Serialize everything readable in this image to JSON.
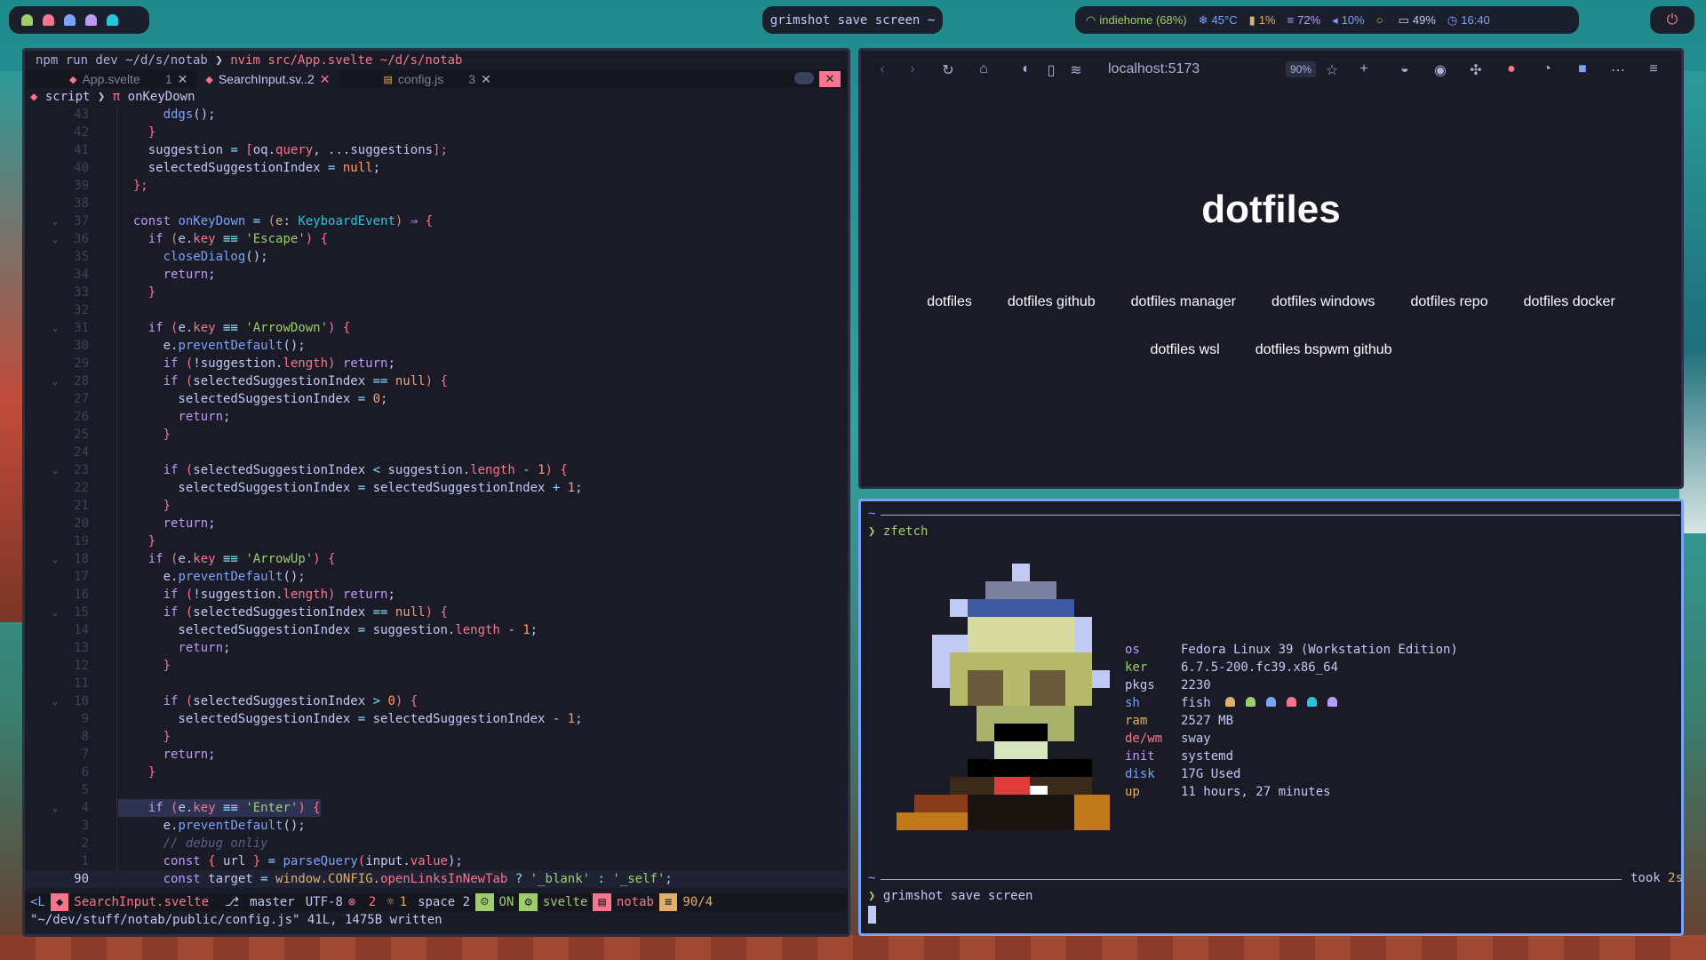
{
  "topbar": {
    "workspace_colors": [
      "#9ece6a",
      "#f7768e",
      "#7aa2f7",
      "#bb9af7",
      "#2ac3de"
    ],
    "screenshot_label": "grimshot save screen ~",
    "status": [
      {
        "icon": "wifi-icon",
        "text": "indiehome (68%)",
        "color": "#9ece6a"
      },
      {
        "icon": "temperature-icon",
        "text": "45°C",
        "color": "#7aa2f7"
      },
      {
        "icon": "cpu-icon",
        "text": "1%",
        "color": "#e0af68"
      },
      {
        "icon": "memory-icon",
        "text": "72%",
        "color": "#bb9af7"
      },
      {
        "icon": "volume-icon",
        "text": "10%",
        "color": "#7aa2f7"
      },
      {
        "icon": "idle-icon",
        "text": "",
        "color": "#e0af68"
      },
      {
        "icon": "battery-icon",
        "text": "49%",
        "color": "#c0caf5"
      },
      {
        "icon": "clock-icon",
        "text": "16:40",
        "color": "#7aa2f7"
      }
    ],
    "power_icon": "power-icon"
  },
  "editor": {
    "title_prefix": "npm run dev ~/d/s/notab",
    "title_cmd": "nvim src/App.svelte ~/d/s/notab",
    "tabs": [
      {
        "name": "App.svelte",
        "count": "1",
        "active": false,
        "icon": "svelte-icon"
      },
      {
        "name": "SearchInput.sv..2",
        "count": "",
        "active": true,
        "icon": "svelte-icon"
      },
      {
        "name": "config.js",
        "count": "3",
        "active": false,
        "icon": "js-icon"
      }
    ],
    "breadcrumb": [
      "script",
      "onKeyDown"
    ],
    "lines": [
      {
        "n": "43",
        "fold": "",
        "code": [
          [
            "      ",
            "v"
          ],
          [
            "ddgs",
            "f"
          ],
          [
            "();",
            "v"
          ]
        ]
      },
      {
        "n": "42",
        "fold": "",
        "code": [
          [
            "    }",
            "p"
          ]
        ]
      },
      {
        "n": "41",
        "fold": "",
        "code": [
          [
            "    suggestion ",
            "v"
          ],
          [
            "=",
            "o"
          ],
          [
            " [",
            "p"
          ],
          [
            "oq.",
            "v"
          ],
          [
            "query",
            "p"
          ],
          [
            ", ...suggestions",
            "v"
          ],
          [
            "];",
            "p"
          ]
        ]
      },
      {
        "n": "40",
        "fold": "",
        "code": [
          [
            "    selectedSuggestionIndex ",
            "v"
          ],
          [
            "=",
            "o"
          ],
          [
            " null",
            "n"
          ],
          [
            ";",
            "v"
          ]
        ]
      },
      {
        "n": "39",
        "fold": "",
        "code": [
          [
            "  };",
            "p"
          ]
        ]
      },
      {
        "n": "38",
        "fold": "",
        "code": [
          [
            "",
            "v"
          ]
        ]
      },
      {
        "n": "37",
        "fold": "v",
        "code": [
          [
            "  ",
            "v"
          ],
          [
            "const",
            "k"
          ],
          [
            " onKeyDown ",
            "f"
          ],
          [
            "=",
            "o"
          ],
          [
            " (",
            "p"
          ],
          [
            "e",
            "r"
          ],
          [
            ": ",
            "v"
          ],
          [
            "KeyboardEvent",
            "t"
          ],
          [
            ") ",
            "p"
          ],
          [
            "⇒",
            "k"
          ],
          [
            " {",
            "p"
          ]
        ]
      },
      {
        "n": "36",
        "fold": "v",
        "code": [
          [
            "    ",
            "v"
          ],
          [
            "if",
            "k"
          ],
          [
            " (",
            "p"
          ],
          [
            "e.",
            "v"
          ],
          [
            "key",
            "p"
          ],
          [
            " ≡≡ ",
            "o"
          ],
          [
            "'Escape'",
            "s"
          ],
          [
            ") {",
            "p"
          ]
        ]
      },
      {
        "n": "35",
        "fold": "",
        "code": [
          [
            "      ",
            "v"
          ],
          [
            "closeDialog",
            "f"
          ],
          [
            "();",
            "v"
          ]
        ]
      },
      {
        "n": "34",
        "fold": "",
        "code": [
          [
            "      ",
            "v"
          ],
          [
            "return",
            "k"
          ],
          [
            ";",
            "v"
          ]
        ]
      },
      {
        "n": "33",
        "fold": "",
        "code": [
          [
            "    }",
            "p"
          ]
        ]
      },
      {
        "n": "32",
        "fold": "",
        "code": [
          [
            "",
            "v"
          ]
        ]
      },
      {
        "n": "31",
        "fold": "v",
        "code": [
          [
            "    ",
            "v"
          ],
          [
            "if",
            "k"
          ],
          [
            " (",
            "p"
          ],
          [
            "e.",
            "v"
          ],
          [
            "key",
            "p"
          ],
          [
            " ≡≡ ",
            "o"
          ],
          [
            "'ArrowDown'",
            "s"
          ],
          [
            ") {",
            "p"
          ]
        ]
      },
      {
        "n": "30",
        "fold": "",
        "code": [
          [
            "      e.",
            "v"
          ],
          [
            "preventDefault",
            "f"
          ],
          [
            "();",
            "v"
          ]
        ]
      },
      {
        "n": "29",
        "fold": "",
        "code": [
          [
            "      ",
            "v"
          ],
          [
            "if",
            "k"
          ],
          [
            " (",
            "p"
          ],
          [
            "!",
            "o"
          ],
          [
            "suggestion.",
            "v"
          ],
          [
            "length",
            "p"
          ],
          [
            ") ",
            "p"
          ],
          [
            "return",
            "k"
          ],
          [
            ";",
            "v"
          ]
        ]
      },
      {
        "n": "28",
        "fold": "v",
        "code": [
          [
            "      ",
            "v"
          ],
          [
            "if",
            "k"
          ],
          [
            " (",
            "p"
          ],
          [
            "selectedSuggestionIndex ",
            "v"
          ],
          [
            "==",
            "o"
          ],
          [
            " null",
            "n"
          ],
          [
            ") {",
            "p"
          ]
        ]
      },
      {
        "n": "27",
        "fold": "",
        "code": [
          [
            "        selectedSuggestionIndex ",
            "v"
          ],
          [
            "=",
            "o"
          ],
          [
            " 0",
            "n"
          ],
          [
            ";",
            "v"
          ]
        ]
      },
      {
        "n": "26",
        "fold": "",
        "code": [
          [
            "        ",
            "v"
          ],
          [
            "return",
            "k"
          ],
          [
            ";",
            "v"
          ]
        ]
      },
      {
        "n": "25",
        "fold": "",
        "code": [
          [
            "      }",
            "p"
          ]
        ]
      },
      {
        "n": "24",
        "fold": "",
        "code": [
          [
            "",
            "v"
          ]
        ]
      },
      {
        "n": "23",
        "fold": "v",
        "code": [
          [
            "      ",
            "v"
          ],
          [
            "if",
            "k"
          ],
          [
            " (",
            "p"
          ],
          [
            "selectedSuggestionIndex ",
            "v"
          ],
          [
            "<",
            "o"
          ],
          [
            " suggestion.",
            "v"
          ],
          [
            "length",
            "p"
          ],
          [
            " - ",
            "o"
          ],
          [
            "1",
            "n"
          ],
          [
            ") {",
            "p"
          ]
        ]
      },
      {
        "n": "22",
        "fold": "",
        "code": [
          [
            "        selectedSuggestionIndex ",
            "v"
          ],
          [
            "=",
            "o"
          ],
          [
            " selectedSuggestionIndex ",
            "v"
          ],
          [
            "+",
            "o"
          ],
          [
            " 1",
            "n"
          ],
          [
            ";",
            "v"
          ]
        ]
      },
      {
        "n": "21",
        "fold": "",
        "code": [
          [
            "      }",
            "p"
          ]
        ]
      },
      {
        "n": "20",
        "fold": "",
        "code": [
          [
            "      ",
            "v"
          ],
          [
            "return",
            "k"
          ],
          [
            ";",
            "v"
          ]
        ]
      },
      {
        "n": "19",
        "fold": "",
        "code": [
          [
            "    }",
            "p"
          ]
        ]
      },
      {
        "n": "18",
        "fold": "v",
        "code": [
          [
            "    ",
            "v"
          ],
          [
            "if",
            "k"
          ],
          [
            " (",
            "p"
          ],
          [
            "e.",
            "v"
          ],
          [
            "key",
            "p"
          ],
          [
            " ≡≡ ",
            "o"
          ],
          [
            "'ArrowUp'",
            "s"
          ],
          [
            ") {",
            "p"
          ]
        ]
      },
      {
        "n": "17",
        "fold": "",
        "code": [
          [
            "      e.",
            "v"
          ],
          [
            "preventDefault",
            "f"
          ],
          [
            "();",
            "v"
          ]
        ]
      },
      {
        "n": "16",
        "fold": "",
        "code": [
          [
            "      ",
            "v"
          ],
          [
            "if",
            "k"
          ],
          [
            " (",
            "p"
          ],
          [
            "!",
            "o"
          ],
          [
            "suggestion.",
            "v"
          ],
          [
            "length",
            "p"
          ],
          [
            ") ",
            "p"
          ],
          [
            "return",
            "k"
          ],
          [
            ";",
            "v"
          ]
        ]
      },
      {
        "n": "15",
        "fold": "v",
        "code": [
          [
            "      ",
            "v"
          ],
          [
            "if",
            "k"
          ],
          [
            " (",
            "p"
          ],
          [
            "selectedSuggestionIndex ",
            "v"
          ],
          [
            "==",
            "o"
          ],
          [
            " null",
            "n"
          ],
          [
            ") {",
            "p"
          ]
        ]
      },
      {
        "n": "14",
        "fold": "",
        "code": [
          [
            "        selectedSuggestionIndex ",
            "v"
          ],
          [
            "=",
            "o"
          ],
          [
            " suggestion.",
            "v"
          ],
          [
            "length",
            "p"
          ],
          [
            " - ",
            "o"
          ],
          [
            "1",
            "n"
          ],
          [
            ";",
            "v"
          ]
        ]
      },
      {
        "n": "13",
        "fold": "",
        "code": [
          [
            "        ",
            "v"
          ],
          [
            "return",
            "k"
          ],
          [
            ";",
            "v"
          ]
        ]
      },
      {
        "n": "12",
        "fold": "",
        "code": [
          [
            "      }",
            "p"
          ]
        ]
      },
      {
        "n": "11",
        "fold": "",
        "code": [
          [
            "",
            "v"
          ]
        ]
      },
      {
        "n": "10",
        "fold": "v",
        "code": [
          [
            "      ",
            "v"
          ],
          [
            "if",
            "k"
          ],
          [
            " (",
            "p"
          ],
          [
            "selectedSuggestionIndex ",
            "v"
          ],
          [
            ">",
            "o"
          ],
          [
            " 0",
            "n"
          ],
          [
            ") {",
            "p"
          ]
        ]
      },
      {
        "n": "9",
        "fold": "",
        "code": [
          [
            "        selectedSuggestionIndex ",
            "v"
          ],
          [
            "=",
            "o"
          ],
          [
            " selectedSuggestionIndex ",
            "v"
          ],
          [
            "-",
            "o"
          ],
          [
            " 1",
            "n"
          ],
          [
            ";",
            "v"
          ]
        ]
      },
      {
        "n": "8",
        "fold": "",
        "code": [
          [
            "      }",
            "p"
          ]
        ]
      },
      {
        "n": "7",
        "fold": "",
        "code": [
          [
            "      ",
            "v"
          ],
          [
            "return",
            "k"
          ],
          [
            ";",
            "v"
          ]
        ]
      },
      {
        "n": "6",
        "fold": "",
        "code": [
          [
            "    }",
            "p"
          ]
        ]
      },
      {
        "n": "5",
        "fold": "",
        "code": [
          [
            "",
            "v"
          ]
        ]
      },
      {
        "n": "4",
        "fold": "v",
        "sel": true,
        "code": [
          [
            "    ",
            "v"
          ],
          [
            "if",
            "k"
          ],
          [
            " (",
            "p"
          ],
          [
            "e.",
            "v"
          ],
          [
            "key",
            "p"
          ],
          [
            " ≡≡ ",
            "o"
          ],
          [
            "'Enter'",
            "s"
          ],
          [
            ") {",
            "p"
          ]
        ]
      },
      {
        "n": "3",
        "fold": "",
        "code": [
          [
            "      e.",
            "v"
          ],
          [
            "preventDefault",
            "f"
          ],
          [
            "();",
            "v"
          ]
        ]
      },
      {
        "n": "2",
        "fold": "",
        "code": [
          [
            "      ",
            "v"
          ],
          [
            "// debug onliy",
            "c"
          ]
        ]
      },
      {
        "n": "1",
        "fold": "",
        "code": [
          [
            "      ",
            "v"
          ],
          [
            "const",
            "k"
          ],
          [
            " { ",
            "p"
          ],
          [
            "url",
            "v"
          ],
          [
            " } ",
            "p"
          ],
          [
            "=",
            "o"
          ],
          [
            " parseQuery",
            "f"
          ],
          [
            "(",
            "p"
          ],
          [
            "input.",
            "v"
          ],
          [
            "value",
            "p"
          ],
          [
            ");",
            "v"
          ]
        ]
      },
      {
        "n": "90",
        "fold": "",
        "cur": true,
        "code": [
          [
            "      ",
            "v"
          ],
          [
            "const",
            "k"
          ],
          [
            " target ",
            "v"
          ],
          [
            "=",
            "o"
          ],
          [
            " window.",
            "r"
          ],
          [
            "CONFIG",
            "r"
          ],
          [
            ".",
            "r"
          ],
          [
            "openLinksInNewTab",
            "p"
          ],
          [
            " ? ",
            "o"
          ],
          [
            "'_blank'",
            "s"
          ],
          [
            " : ",
            "o"
          ],
          [
            "'_self'",
            "s"
          ],
          [
            ";",
            "v"
          ]
        ]
      }
    ],
    "status": {
      "mode": "<L",
      "file": "SearchInput.svelte",
      "branch": "master",
      "encoding": "UTF-8",
      "errors": "2",
      "hints": "1",
      "indent": "space 2",
      "copilot": "ON",
      "filetype": "svelte",
      "project": "notab",
      "position": "90/4"
    },
    "cmdline": "\"~/dev/stuff/notab/public/config.js\" 41L, 1475B written"
  },
  "browser": {
    "url": "localhost:5173",
    "zoom": "90%",
    "page_title": "dotfiles",
    "links": [
      "dotfiles",
      "dotfiles github",
      "dotfiles manager",
      "dotfiles windows",
      "dotfiles repo",
      "dotfiles docker",
      "dotfiles wsl",
      "dotfiles bspwm github"
    ]
  },
  "terminal": {
    "prompt_symbol": "❯",
    "home": "~",
    "command1": "zfetch",
    "fetch": [
      {
        "label": "os",
        "value": "Fedora Linux 39 (Workstation Edition)",
        "color": "#bb9af7"
      },
      {
        "label": "ker",
        "value": "6.7.5-200.fc39.x86_64",
        "color": "#9ece6a"
      },
      {
        "label": "pkgs",
        "value": "2230",
        "color": "#c0caf5"
      },
      {
        "label": "sh",
        "value": "fish",
        "color": "#7aa2f7"
      },
      {
        "label": "ram",
        "value": "2527 MB",
        "color": "#e0af68"
      },
      {
        "label": "de/wm",
        "value": "sway",
        "color": "#f7768e"
      },
      {
        "label": "init",
        "value": "systemd",
        "color": "#bb9af7"
      },
      {
        "label": "disk",
        "value": "17G Used",
        "color": "#7aa2f7"
      },
      {
        "label": "up",
        "value": "11 hours, 27 minutes",
        "color": "#e0af68"
      }
    ],
    "took": "took",
    "duration": "2s",
    "command2": "grimshot save screen"
  }
}
